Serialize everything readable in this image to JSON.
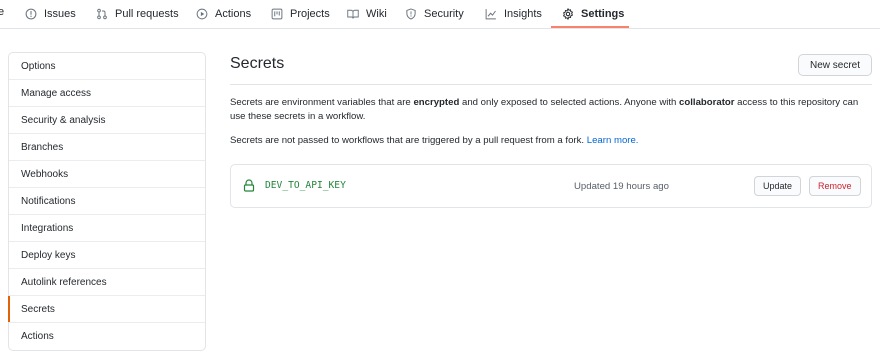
{
  "nav": {
    "edge_text": "e",
    "tabs": [
      {
        "label": "Issues",
        "icon": "issue-icon"
      },
      {
        "label": "Pull requests",
        "icon": "pull-request-icon"
      },
      {
        "label": "Actions",
        "icon": "play-icon"
      },
      {
        "label": "Projects",
        "icon": "project-icon"
      },
      {
        "label": "Wiki",
        "icon": "book-icon"
      },
      {
        "label": "Security",
        "icon": "shield-icon"
      },
      {
        "label": "Insights",
        "icon": "graph-icon"
      },
      {
        "label": "Settings",
        "icon": "gear-icon",
        "selected": true
      }
    ],
    "accent_color": "#f9826c"
  },
  "menu": {
    "items": [
      {
        "label": "Options"
      },
      {
        "label": "Manage access"
      },
      {
        "label": "Security & analysis"
      },
      {
        "label": "Branches"
      },
      {
        "label": "Webhooks"
      },
      {
        "label": "Notifications"
      },
      {
        "label": "Integrations"
      },
      {
        "label": "Deploy keys"
      },
      {
        "label": "Autolink references"
      },
      {
        "label": "Secrets",
        "selected": true
      },
      {
        "label": "Actions"
      }
    ]
  },
  "main": {
    "title": "Secrets",
    "new_button": "New secret",
    "desc1": {
      "p1": "Secrets are environment variables that are ",
      "b1": "encrypted",
      "p2": " and only exposed to selected actions. Anyone with ",
      "b2": "collaborator",
      "p3": " access to this repository can use these secrets in a workflow."
    },
    "desc2": {
      "text": "Secrets are not passed to workflows that are triggered by a pull request from a fork. ",
      "link": "Learn more."
    },
    "secrets": [
      {
        "name": "DEV_TO_API_KEY",
        "updated": "Updated 19 hours ago",
        "update_label": "Update",
        "remove_label": "Remove"
      }
    ]
  }
}
